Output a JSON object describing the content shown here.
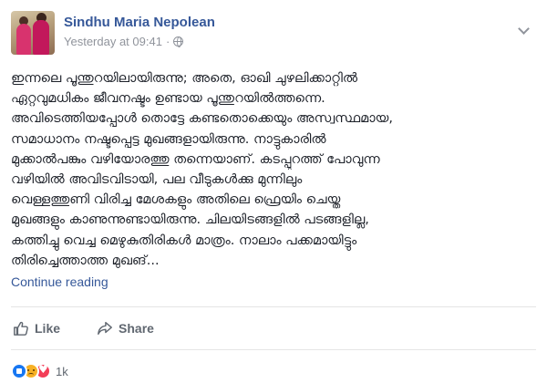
{
  "post": {
    "author_name": "Sindhu Maria Nepolean",
    "timestamp": "Yesterday at 09:41",
    "separator": "·",
    "audience_icon": "globe-icon",
    "body_lines": [
      "ഇന്നലെ പൂന്തുറയിലായിരുന്നു; അതെ, ഓഖി ചുഴലിക്കാറ്റിൽ",
      "ഏറ്റവുമധികം ജീവനഷ്ടം ഉണ്ടായ പൂന്തുറയിൽത്തന്നെ.",
      "അവിടെത്തിയപ്പോൾ തൊട്ടേ കണ്ടതൊക്കെയും അസ്വസ്ഥമായ,",
      "സമാധാനം നഷ്ടപ്പെട്ട മുഖങ്ങളായിരുന്നു. നാട്ടുകാരിൽ",
      "മുക്കാൽപങ്കും വഴിയോരത്തു തന്നെയാണ്. കടപ്പുറത്ത് പോവുന്ന",
      "വഴിയിൽ അവിടവിടായി, പല വീടുകൾക്കു മുന്നിലും",
      "വെള്ളത്തുണി വിരിച്ച മേശകളും അതിലെ ഫ്രെയിം ചെയ്ത",
      "മുഖങ്ങളും കാണുന്നുണ്ടായിരുന്നു. ചിലയിടങ്ങളിൽ പടങ്ങളില്ല,",
      "കത്തിച്ചു വെച്ച മെഴുകുതിരികൾ മാത്രം. നാലാം പക്കമായിട്ടും",
      "തിരിച്ചെത്താത്ത മുഖങ്..."
    ],
    "continue_label": "Continue reading"
  },
  "actions": {
    "like_label": "Like",
    "share_label": "Share"
  },
  "reactions": {
    "types": [
      "like",
      "sad",
      "love"
    ],
    "count": "1k"
  },
  "colors": {
    "link": "#365899",
    "text": "#1d2129",
    "muted": "#90949c",
    "like_blue": "#1877f2",
    "love_red": "#f33e58",
    "sad_yellow": "#f7b125"
  }
}
